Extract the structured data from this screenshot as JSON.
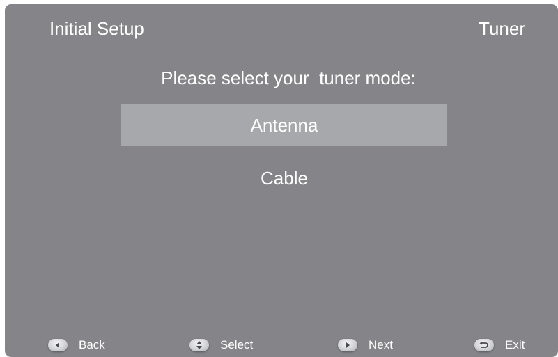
{
  "header": {
    "title": "Initial Setup",
    "section": "Tuner"
  },
  "prompt": "Please select your  tuner mode:",
  "options": [
    {
      "label": "Antenna",
      "selected": true
    },
    {
      "label": "Cable",
      "selected": false
    }
  ],
  "footer": {
    "back": {
      "label": "Back",
      "icon": "left-arrow-button-icon"
    },
    "select": {
      "label": "Select",
      "icon": "up-down-arrow-button-icon"
    },
    "next": {
      "label": "Next",
      "icon": "right-arrow-button-icon"
    },
    "exit": {
      "label": "Exit",
      "icon": "return-arrow-button-icon"
    }
  },
  "colors": {
    "background": "#858589",
    "highlight": "#a7a8ab",
    "text": "#ffffff"
  }
}
